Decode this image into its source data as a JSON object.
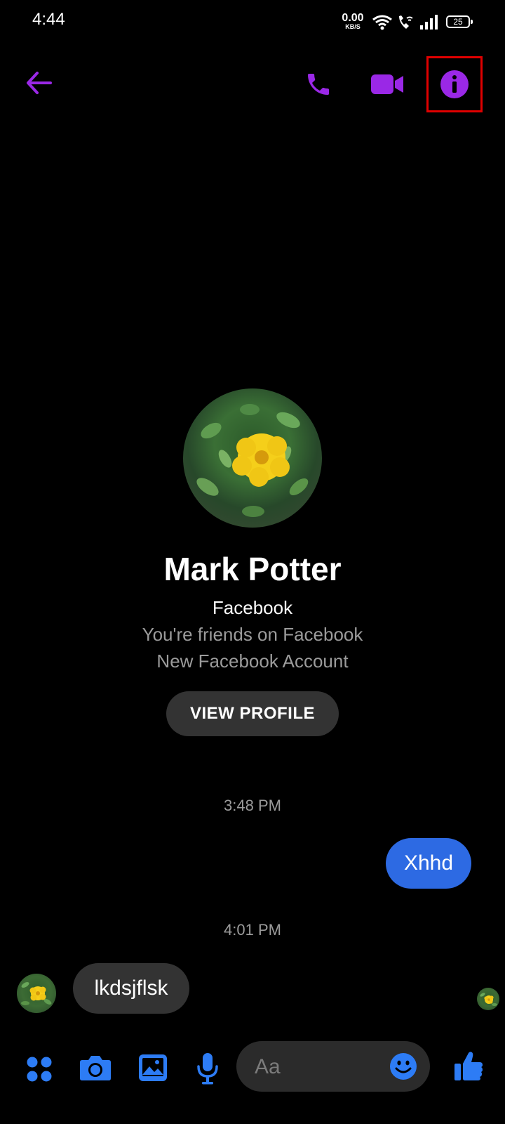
{
  "status_bar": {
    "time": "4:44",
    "net_speed_value": "0.00",
    "net_speed_unit": "KB/S",
    "battery": "25",
    "icons": [
      "wifi-icon",
      "wifi-calling-icon",
      "signal-icon",
      "battery-icon"
    ]
  },
  "app_bar": {
    "icons": [
      "back-arrow-icon",
      "phone-icon",
      "video-camera-icon",
      "info-icon"
    ],
    "accent_color": "#9a28e6",
    "highlight_color": "#e00000"
  },
  "profile": {
    "name": "Mark Potter",
    "platform": "Facebook",
    "relationship": "You're friends on Facebook",
    "account_note": "New Facebook Account",
    "view_profile_label": "VIEW PROFILE"
  },
  "messages": [
    {
      "timestamp": "3:48 PM",
      "direction": "outgoing",
      "text": "Xhhd"
    },
    {
      "timestamp": "4:01 PM",
      "direction": "incoming",
      "text": "lkdsjflsk"
    }
  ],
  "composer": {
    "placeholder": "Aa",
    "icons": [
      "menu-dots-icon",
      "camera-icon",
      "gallery-icon",
      "microphone-icon",
      "emoji-icon",
      "thumbs-up-icon"
    ],
    "accent_color": "#2d7cf5"
  }
}
